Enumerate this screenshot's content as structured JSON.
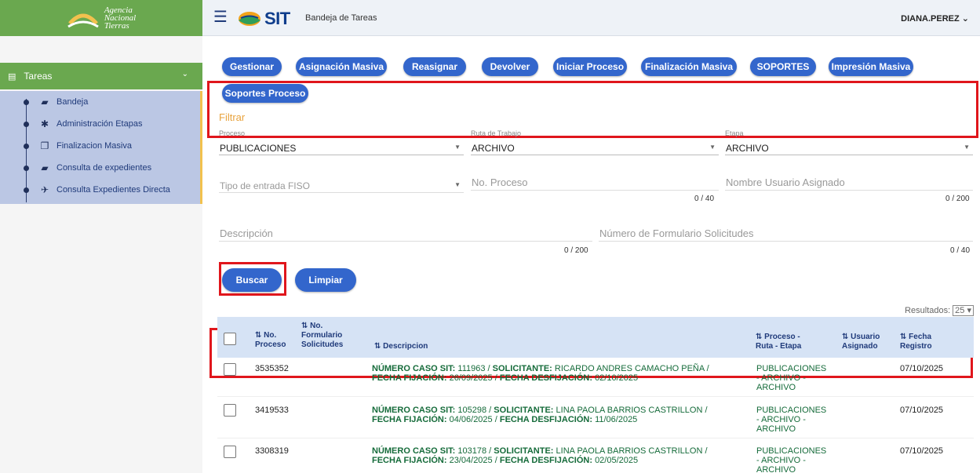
{
  "logo": {
    "line1": "Agencia",
    "line2": "Nacional",
    "line3": "Tierras"
  },
  "sidebar": {
    "section_label": "Tareas",
    "items": [
      {
        "label": "Bandeja",
        "icon": "folder-open-icon"
      },
      {
        "label": "Administración Etapas",
        "icon": "gear-icon"
      },
      {
        "label": "Finalizacion Masiva",
        "icon": "copy-icon"
      },
      {
        "label": "Consulta de expedientes",
        "icon": "folder-open-icon"
      },
      {
        "label": "Consulta Expedientes Directa",
        "icon": "plane-icon"
      }
    ]
  },
  "header": {
    "brand": "SIT",
    "subtitle": "Bandeja de Tareas",
    "user": "DIANA.PEREZ"
  },
  "toolbar": {
    "buttons": [
      "Gestionar",
      "Asignación Masiva",
      "Reasignar",
      "Devolver",
      "Iniciar Proceso",
      "Finalización Masiva",
      "SOPORTES",
      "Impresión Masiva",
      "Soportes Proceso"
    ]
  },
  "filter": {
    "title": "Filtrar",
    "proceso": {
      "label": "Proceso",
      "value": "PUBLICACIONES"
    },
    "ruta": {
      "label": "Ruta de Trabajo",
      "value": "ARCHIVO"
    },
    "etapa": {
      "label": "Etapa",
      "value": "ARCHIVO"
    },
    "tipo_entrada": {
      "placeholder": "Tipo de entrada FISO"
    },
    "no_proceso": {
      "placeholder": "No. Proceso",
      "counter": "0 / 40"
    },
    "usuario": {
      "placeholder": "Nombre Usuario Asignado",
      "counter": "0 / 200"
    },
    "descripcion": {
      "placeholder": "Descripción",
      "counter": "0 / 200"
    },
    "formulario": {
      "placeholder": "Número de Formulario Solicitudes",
      "counter": "0 / 40"
    },
    "search_label": "Buscar",
    "clear_label": "Limpiar"
  },
  "results": {
    "label": "Resultados:",
    "page_size": "25"
  },
  "table": {
    "headers": {
      "no_proceso": "No. Proceso",
      "no_formulario": "No. Formulario Solicitudes",
      "descripcion": "Descripcion",
      "proceso_ruta_etapa": "Proceso - Ruta - Etapa",
      "usuario": "Usuario Asignado",
      "fecha": "Fecha Registro"
    },
    "rows": [
      {
        "no_proceso": "3535352",
        "caso": "111963",
        "solicitante": "RICARDO ANDRES CAMACHO PEÑA",
        "fijacion": "26/09/2025",
        "desfijacion": "02/10/2025",
        "proceso": "PUBLICACIONES",
        "ruta": "- ARCHIVO -",
        "etapa": "ARCHIVO",
        "fecha": "07/10/2025"
      },
      {
        "no_proceso": "3419533",
        "caso": "105298",
        "solicitante": "LINA PAOLA BARRIOS CASTRILLON",
        "fijacion": "04/06/2025",
        "desfijacion": "11/06/2025",
        "proceso": "PUBLICACIONES",
        "ruta": "- ARCHIVO -",
        "etapa": "ARCHIVO",
        "fecha": "07/10/2025"
      },
      {
        "no_proceso": "3308319",
        "caso": "103178",
        "solicitante": "LINA PAOLA BARRIOS CASTRILLON",
        "fijacion": "23/04/2025",
        "desfijacion": "02/05/2025",
        "proceso": "PUBLICACIONES",
        "ruta": "- ARCHIVO -",
        "etapa": "ARCHIVO",
        "fecha": "07/10/2025"
      }
    ],
    "labels": {
      "caso": "NÚMERO CASO SIT:",
      "solicitante": "SOLICITANTE:",
      "fijacion": "FECHA FIJACIÓN:",
      "desfijacion": "FECHA DESFIJACIÓN:"
    }
  },
  "colors": {
    "brand_green": "#6aa84f",
    "button_blue": "#3366cc",
    "highlight_red": "#e0161c",
    "accent_orange": "#e8a33d"
  }
}
